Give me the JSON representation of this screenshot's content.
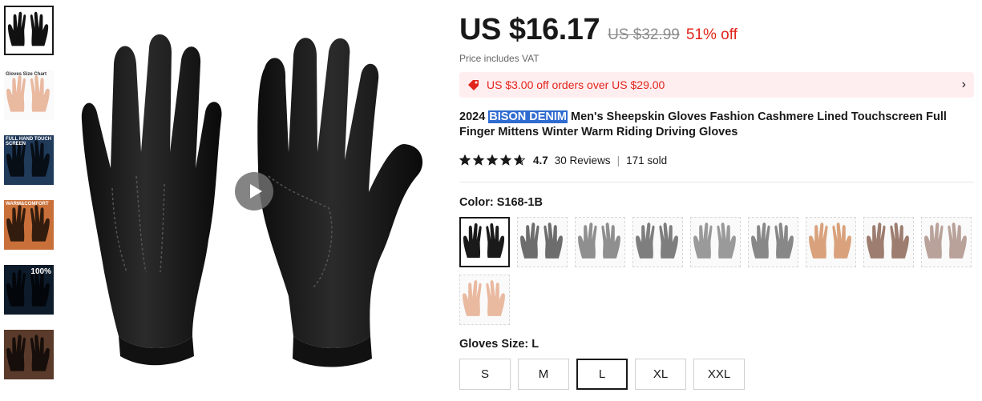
{
  "product": {
    "price": "US $16.17",
    "original_price": "US $32.99",
    "discount": "51% off",
    "vat_note": "Price includes VAT",
    "coupon_text": "US $3.00 off orders over US $29.00",
    "title_prefix": "2024 ",
    "title_highlight": "BISON DENIM",
    "title_rest": " Men's Sheepskin Gloves Fashion Cashmere Lined Touchscreen Full Finger Mittens Winter Warm Riding Driving Gloves",
    "rating": "4.7",
    "reviews": "30 Reviews",
    "rating_separator": "|",
    "sold": "171 sold",
    "stars": 4.7
  },
  "gallery": {
    "thumbnails": [
      {
        "name": "thumb-black-gloves",
        "selected": true,
        "text": ""
      },
      {
        "name": "thumb-size-chart",
        "selected": false,
        "text": "Gloves Size Chart"
      },
      {
        "name": "thumb-touchscreen",
        "selected": false,
        "text": "FULL HAND TOUCH SCREEN"
      },
      {
        "name": "thumb-warm-comfort",
        "selected": false,
        "text": "WARM&COMFORT"
      },
      {
        "name": "thumb-waterproof",
        "selected": false,
        "text": "100%"
      },
      {
        "name": "thumb-model",
        "selected": false,
        "text": ""
      }
    ]
  },
  "color": {
    "label": "Color: S168-1B",
    "options": [
      {
        "color": "#1a1a1a",
        "selected": true
      },
      {
        "color": "#6d6d6d",
        "selected": false
      },
      {
        "color": "#8f8f8f",
        "selected": false
      },
      {
        "color": "#7e7e7e",
        "selected": false
      },
      {
        "color": "#9a9a9a",
        "selected": false
      },
      {
        "color": "#888888",
        "selected": false
      },
      {
        "color": "#d9a27c",
        "selected": false
      },
      {
        "color": "#9c7d6f",
        "selected": false
      },
      {
        "color": "#b9a29a",
        "selected": false
      },
      {
        "color": "#e9b9a0",
        "selected": false
      }
    ]
  },
  "size": {
    "label": "Gloves Size: L",
    "options": [
      "S",
      "M",
      "L",
      "XL",
      "XXL"
    ],
    "selected": "L"
  },
  "colors": {
    "accent": "#e1251b",
    "coupon_bg": "#ffeef0",
    "highlight": "#2f6bd0"
  }
}
